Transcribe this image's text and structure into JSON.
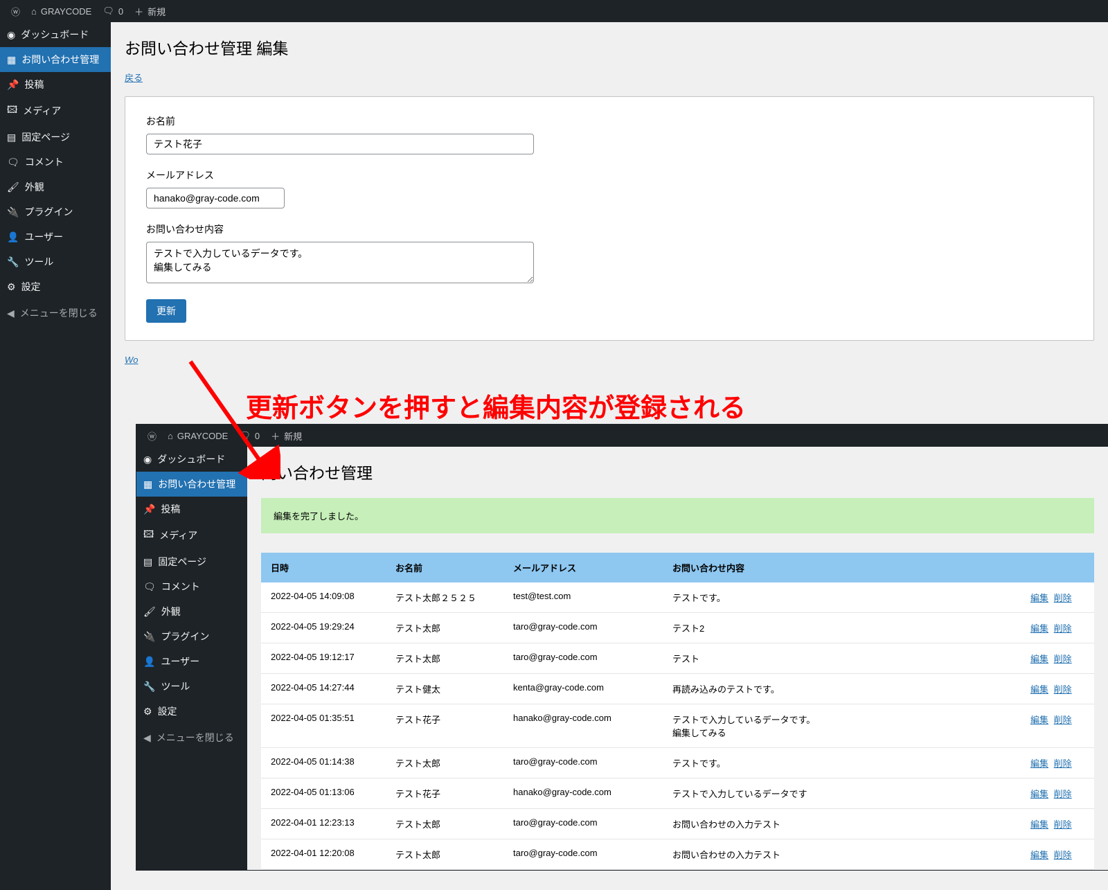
{
  "topbar": {
    "site_name": "GRAYCODE",
    "comments": "0",
    "new": "新規"
  },
  "sidebar": {
    "items": [
      {
        "label": "ダッシュボード",
        "icon": "dashboard"
      },
      {
        "label": "お問い合わせ管理",
        "icon": "form",
        "active": true
      },
      {
        "label": "投稿",
        "icon": "pin"
      },
      {
        "label": "メディア",
        "icon": "media"
      },
      {
        "label": "固定ページ",
        "icon": "page"
      },
      {
        "label": "コメント",
        "icon": "comment"
      },
      {
        "label": "外観",
        "icon": "appearance"
      },
      {
        "label": "プラグイン",
        "icon": "plugin"
      },
      {
        "label": "ユーザー",
        "icon": "user"
      },
      {
        "label": "ツール",
        "icon": "tool"
      },
      {
        "label": "設定",
        "icon": "settings"
      }
    ],
    "collapse": "メニューを閉じる"
  },
  "page": {
    "title": "お問い合わせ管理 編集",
    "back": "戻る",
    "name_label": "お名前",
    "name_value": "テスト花子",
    "email_label": "メールアドレス",
    "email_value": "hanako@gray-code.com",
    "content_label": "お問い合わせ内容",
    "content_value": "テストで入力しているデータです。\n編集してみる",
    "submit": "更新",
    "footer": "Wo"
  },
  "annotation": "更新ボタンを押すと編集内容が登録される",
  "overlay": {
    "title": "問い合わせ管理",
    "notice": "編集を完了しました。",
    "headers": {
      "date": "日時",
      "name": "お名前",
      "email": "メールアドレス",
      "content": "お問い合わせ内容"
    },
    "actions": {
      "edit": "編集",
      "delete": "削除"
    },
    "rows": [
      {
        "date": "2022-04-05 14:09:08",
        "name": "テスト太郎２５２５",
        "email": "test@test.com",
        "content": "テストです。"
      },
      {
        "date": "2022-04-05 19:29:24",
        "name": "テスト太郎",
        "email": "taro@gray-code.com",
        "content": "テスト2"
      },
      {
        "date": "2022-04-05 19:12:17",
        "name": "テスト太郎",
        "email": "taro@gray-code.com",
        "content": "テスト"
      },
      {
        "date": "2022-04-05 14:27:44",
        "name": "テスト健太",
        "email": "kenta@gray-code.com",
        "content": "再読み込みのテストです。"
      },
      {
        "date": "2022-04-05 01:35:51",
        "name": "テスト花子",
        "email": "hanako@gray-code.com",
        "content": "テストで入力しているデータです。\n編集してみる"
      },
      {
        "date": "2022-04-05 01:14:38",
        "name": "テスト太郎",
        "email": "taro@gray-code.com",
        "content": "テストです。"
      },
      {
        "date": "2022-04-05 01:13:06",
        "name": "テスト花子",
        "email": "hanako@gray-code.com",
        "content": "テストで入力しているデータです"
      },
      {
        "date": "2022-04-01 12:23:13",
        "name": "テスト太郎",
        "email": "taro@gray-code.com",
        "content": "お問い合わせの入力テスト"
      },
      {
        "date": "2022-04-01 12:20:08",
        "name": "テスト太郎",
        "email": "taro@gray-code.com",
        "content": "お問い合わせの入力テスト"
      }
    ]
  }
}
